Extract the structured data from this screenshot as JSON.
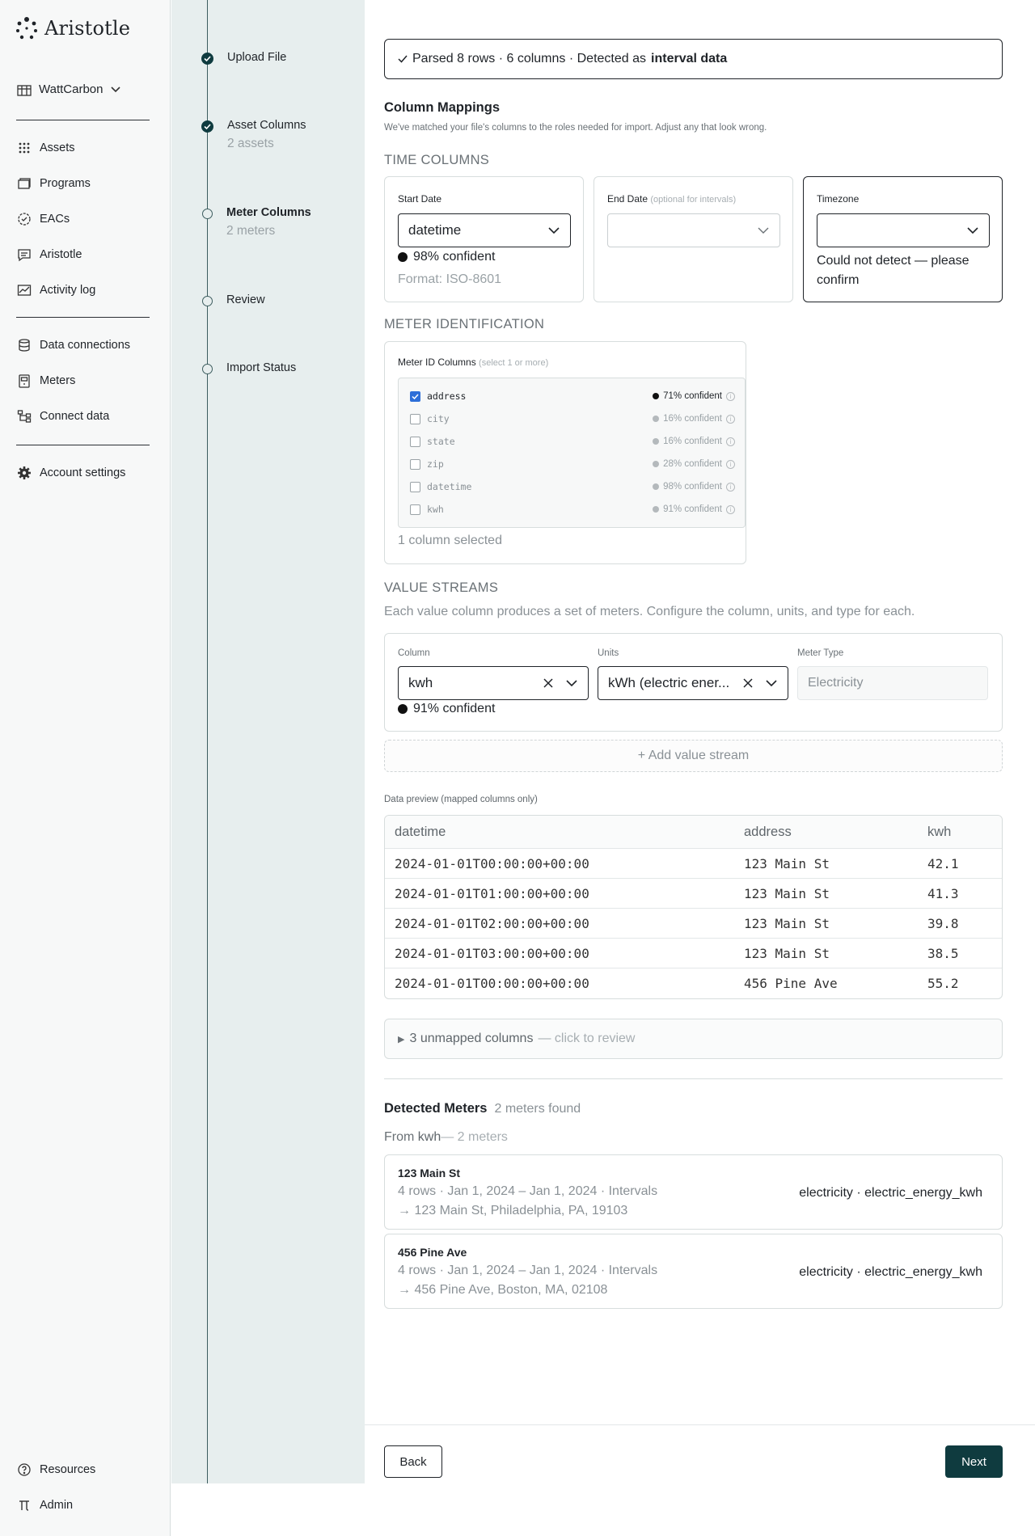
{
  "app": {
    "name": "Aristotle",
    "org": "WattCarbon"
  },
  "nav": {
    "group1": [
      {
        "label": "Assets",
        "icon": "grid-dots-icon"
      },
      {
        "label": "Programs",
        "icon": "folders-icon"
      },
      {
        "label": "EACs",
        "icon": "badge-check-icon"
      },
      {
        "label": "Aristotle",
        "icon": "chat-icon"
      },
      {
        "label": "Activity log",
        "icon": "chart-icon"
      }
    ],
    "group2": [
      {
        "label": "Data connections",
        "icon": "database-icon"
      },
      {
        "label": "Meters",
        "icon": "meter-icon"
      },
      {
        "label": "Connect data",
        "icon": "connect-icon"
      }
    ],
    "group3": [
      {
        "label": "Account settings",
        "icon": "gear-icon"
      }
    ],
    "bottom": [
      {
        "label": "Resources",
        "icon": "help-icon"
      },
      {
        "label": "Admin",
        "icon": "pi-icon"
      }
    ]
  },
  "steps": [
    {
      "label": "Upload File",
      "sub": "",
      "status": "done"
    },
    {
      "label": "Asset Columns",
      "sub": "2 assets",
      "status": "done"
    },
    {
      "label": "Meter Columns",
      "sub": "2 meters",
      "status": "active"
    },
    {
      "label": "Review",
      "sub": "",
      "status": "todo"
    },
    {
      "label": "Import Status",
      "sub": "",
      "status": "todo"
    }
  ],
  "banner": {
    "prefix": "Parsed 8 rows · 6 columns · Detected as",
    "strong": "interval data"
  },
  "mappings": {
    "title": "Column Mappings",
    "subtitle": "We've matched your file's columns to the roles needed for import. Adjust any that look wrong."
  },
  "time": {
    "label": "TIME COLUMNS",
    "start": {
      "label": "Start Date",
      "value": "datetime",
      "confidence": "98% confident",
      "format": "Format: ISO-8601"
    },
    "end": {
      "label": "End Date",
      "hint": "(optional for intervals)",
      "value": ""
    },
    "tz": {
      "label": "Timezone",
      "value": "",
      "message": "Could not detect — please confirm"
    }
  },
  "meterid": {
    "label": "METER IDENTIFICATION",
    "field_label": "Meter ID Columns",
    "hint": "(select 1 or more)",
    "items": [
      {
        "name": "address",
        "conf": "71% confident",
        "checked": true
      },
      {
        "name": "city",
        "conf": "16% confident",
        "checked": false
      },
      {
        "name": "state",
        "conf": "16% confident",
        "checked": false
      },
      {
        "name": "zip",
        "conf": "28% confident",
        "checked": false
      },
      {
        "name": "datetime",
        "conf": "98% confident",
        "checked": false
      },
      {
        "name": "kwh",
        "conf": "91% confident",
        "checked": false
      }
    ],
    "selected": "1 column selected"
  },
  "streams": {
    "label": "VALUE STREAMS",
    "desc": "Each value column produces a set of meters. Configure the column, units, and type for each.",
    "column_label": "Column",
    "column_value": "kwh",
    "column_conf": "91% confident",
    "units_label": "Units",
    "units_value": "kWh (electric ener...",
    "type_label": "Meter Type",
    "type_value": "Electricity",
    "add": "+ Add value stream"
  },
  "preview": {
    "title": "Data preview (mapped columns only)",
    "headers": [
      "datetime",
      "address",
      "kwh"
    ],
    "rows": [
      [
        "2024-01-01T00:00:00+00:00",
        "123 Main St",
        "42.1"
      ],
      [
        "2024-01-01T01:00:00+00:00",
        "123 Main St",
        "41.3"
      ],
      [
        "2024-01-01T02:00:00+00:00",
        "123 Main St",
        "39.8"
      ],
      [
        "2024-01-01T03:00:00+00:00",
        "123 Main St",
        "38.5"
      ],
      [
        "2024-01-01T00:00:00+00:00",
        "456 Pine Ave",
        "55.2"
      ]
    ]
  },
  "unmapped": {
    "text": "3 unmapped columns",
    "hint": "— click to review"
  },
  "detected": {
    "title": "Detected Meters",
    "count": "2 meters found",
    "from_prefix": "From",
    "from_col": "kwh",
    "from_suffix": "— 2 meters",
    "meters": [
      {
        "name": "123 Main St",
        "info": "4 rows · Jan 1, 2024 – Jan 1, 2024 · Intervals",
        "addr": "→ 123 Main St, Philadelphia, PA, 19103",
        "type": "electricity · electric_energy_kwh"
      },
      {
        "name": "456 Pine Ave",
        "info": "4 rows · Jan 1, 2024 – Jan 1, 2024 · Intervals",
        "addr": "→ 456 Pine Ave, Boston, MA, 02108",
        "type": "electricity · electric_energy_kwh"
      }
    ]
  },
  "footer": {
    "back": "Back",
    "next": "Next"
  },
  "colors": {
    "accent": "#0f3b3f",
    "stepper_bg": "#e7eeee",
    "checkbox": "#2e6fd8"
  }
}
